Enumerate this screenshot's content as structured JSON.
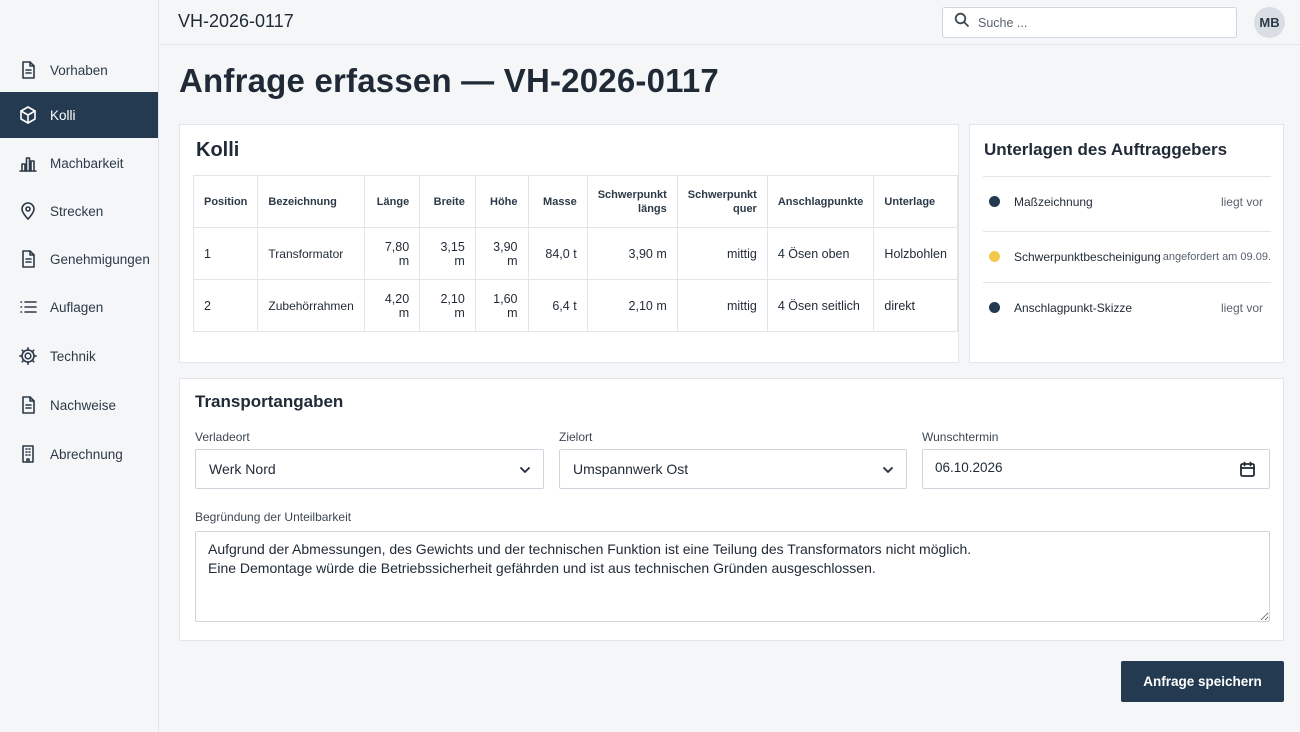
{
  "topbar": {
    "breadcrumb": "VH-2026-0117",
    "search_placeholder": "Suche ...",
    "avatar_initials": "MB"
  },
  "sidebar": {
    "items": [
      {
        "label": "Vorhaben",
        "icon": "document-icon"
      },
      {
        "label": "Kolli",
        "icon": "package-icon",
        "active": true
      },
      {
        "label": "Machbarkeit",
        "icon": "bar-chart-icon"
      },
      {
        "label": "Strecken",
        "icon": "map-pin-icon"
      },
      {
        "label": "Genehmigungen",
        "icon": "document-icon"
      },
      {
        "label": "Auflagen",
        "icon": "list-icon"
      },
      {
        "label": "Technik",
        "icon": "gear-icon"
      },
      {
        "label": "Nachweise",
        "icon": "document-icon"
      },
      {
        "label": "Abrechnung",
        "icon": "building-icon"
      }
    ]
  },
  "page_title": "Anfrage erfassen — VH-2026-0117",
  "kolli": {
    "title": "Kolli",
    "headers": [
      "Position",
      "Bezeichnung",
      "Länge",
      "Breite",
      "Höhe",
      "Masse",
      "Schwerpunkt längs",
      "Schwerpunkt quer",
      "Anschlagpunkte",
      "Unterlage"
    ],
    "rows": [
      [
        "1",
        "Transformator",
        "7,80 m",
        "3,15 m",
        "3,90 m",
        "84,0 t",
        "3,90 m",
        "mittig",
        "4 Ösen oben",
        "Holzbohlen"
      ],
      [
        "2",
        "Zubehörrahmen",
        "4,20 m",
        "2,10 m",
        "1,60 m",
        "6,4 t",
        "2,10 m",
        "mittig",
        "4 Ösen seitlich",
        "direkt"
      ]
    ]
  },
  "unterlagen": {
    "title": "Unterlagen des Auftraggebers",
    "items": [
      {
        "name": "Maßzeichnung",
        "status": "liegt vor",
        "color": "#243a51"
      },
      {
        "name": "Schwerpunktbescheinigung",
        "status": "angefordert am 09.09.",
        "color": "#f2c94c"
      },
      {
        "name": "Anschlagpunkt-Skizze",
        "status": "liegt vor",
        "color": "#243a51"
      }
    ]
  },
  "transport": {
    "title": "Transportangaben",
    "verladeort_label": "Verladeort",
    "verladeort_value": "Werk Nord",
    "zielort_label": "Zielort",
    "zielort_value": "Umspannwerk Ost",
    "wunschtermin_label": "Wunschtermin",
    "wunschtermin_value": "06.10.2026",
    "begruendung_label": "Begründung der Unteilbarkeit",
    "begruendung_value": "Aufgrund der Abmessungen, des Gewichts und der technischen Funktion ist eine Teilung des Transformators nicht möglich.\nEine Demontage würde die Betriebssicherheit gefährden und ist aus technischen Gründen ausgeschlossen."
  },
  "save_label": "Anfrage speichern"
}
